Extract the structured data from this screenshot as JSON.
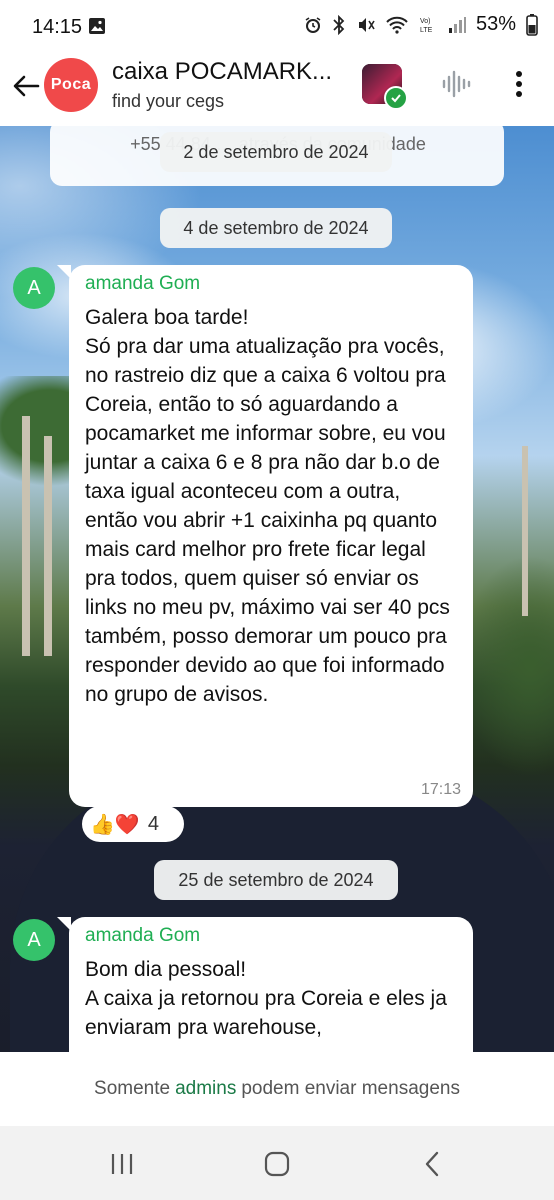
{
  "status_bar": {
    "time": "14:15",
    "battery": "53%",
    "icons": [
      "gallery-icon",
      "alarm-icon",
      "bluetooth-icon",
      "mute-icon",
      "wifi-icon",
      "volte-icon",
      "signal-icon",
      "battery-icon"
    ]
  },
  "header": {
    "group_title": "caixa POCAMARK...",
    "group_subtitle": "find your cegs",
    "avatar_text": "Poca"
  },
  "chat": {
    "system_notice": "+55 44 84 … através da comunidade",
    "floating_date": "2 de setembro de 2024",
    "date_1": "4 de setembro de 2024",
    "date_2": "25 de setembro de 2024",
    "messages": [
      {
        "avatar": "A",
        "sender": "amanda Gom",
        "text": "Galera boa tarde!\nSó pra dar uma atualização pra vocês, no rastreio diz que a caixa 6 voltou pra Coreia, então to só aguardando a pocamarket me informar sobre, eu vou juntar a caixa 6 e 8 pra não dar b.o de taxa igual aconteceu com a outra, então vou abrir +1 caixinha pq quanto mais card melhor pro frete ficar legal pra todos, quem quiser só enviar os links no meu pv, máximo vai ser 40 pcs também, posso demorar um pouco pra responder devido ao que foi informado no grupo de avisos.",
        "time": "17:13",
        "reactions": {
          "emojis": "👍❤️",
          "count": "4"
        }
      },
      {
        "avatar": "A",
        "sender": "amanda Gom",
        "text": "Bom dia pessoal!\nA caixa ja retornou pra Coreia e eles ja enviaram pra warehouse,",
        "time": ""
      }
    ]
  },
  "footer": {
    "prefix": "Somente",
    "link": "admins",
    "suffix": "podem enviar mensagens"
  },
  "colors": {
    "sender_green": "#1fae53",
    "avatar_green": "#35c26b",
    "poca_red": "#f0494a",
    "admins_green": "#1b7a47"
  }
}
